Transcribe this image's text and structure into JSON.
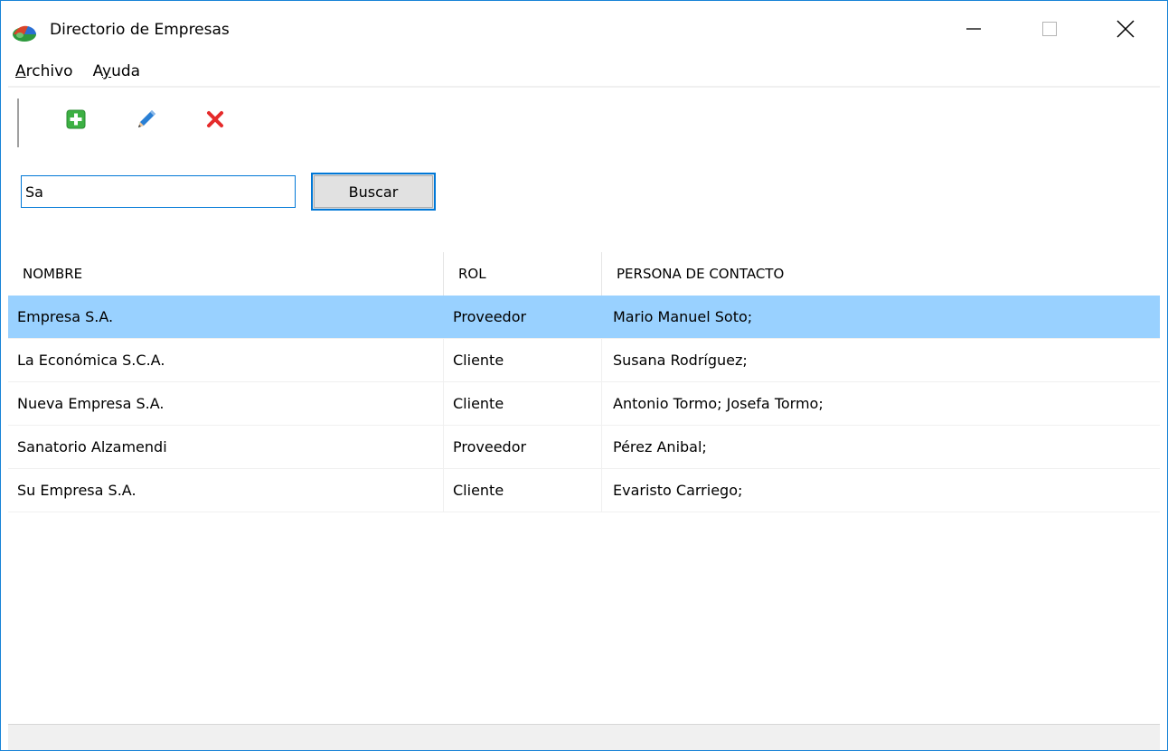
{
  "window": {
    "title": "Directorio de Empresas",
    "accent_color": "#1883d7"
  },
  "menu": {
    "items": [
      {
        "accel": "A",
        "rest": "rchivo"
      },
      {
        "pre": "A",
        "accel": "y",
        "rest": "uda"
      }
    ]
  },
  "toolbar": {
    "buttons": [
      {
        "icon": "add-icon",
        "color": "#3cb043"
      },
      {
        "icon": "edit-pencil-icon",
        "color": "#2a7fd4"
      },
      {
        "icon": "delete-icon",
        "color": "#e52b2b"
      }
    ]
  },
  "search": {
    "value": "Sa",
    "button_label": "Buscar"
  },
  "list": {
    "columns": [
      "NOMBRE",
      "ROL",
      "PERSONA DE CONTACTO"
    ],
    "selected_color": "#99d1ff",
    "rows": [
      {
        "nombre": "Empresa S.A.",
        "rol": "Proveedor",
        "contacto": "Mario Manuel Soto;",
        "selected": true
      },
      {
        "nombre": "La Económica S.C.A.",
        "rol": "Cliente",
        "contacto": "Susana Rodríguez;",
        "selected": false
      },
      {
        "nombre": "Nueva Empresa S.A.",
        "rol": "Cliente",
        "contacto": "Antonio Tormo; Josefa Tormo;",
        "selected": false
      },
      {
        "nombre": "Sanatorio Alzamendi",
        "rol": "Proveedor",
        "contacto": "Pérez Anibal;",
        "selected": false
      },
      {
        "nombre": "Su Empresa S.A.",
        "rol": "Cliente",
        "contacto": "Evaristo Carriego;",
        "selected": false
      }
    ]
  }
}
